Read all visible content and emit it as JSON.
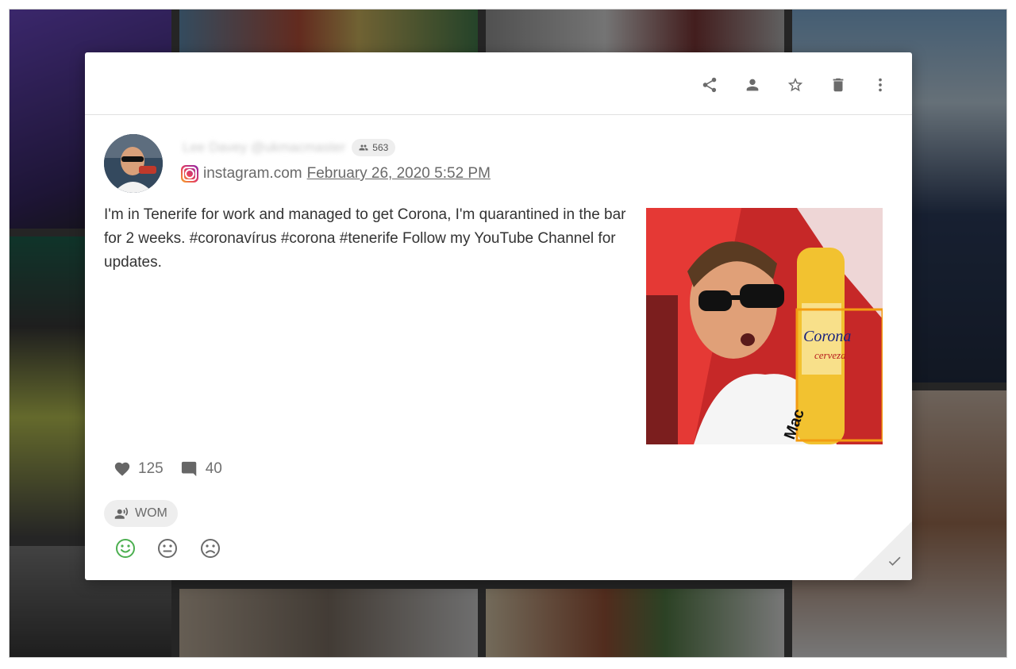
{
  "toolbar": {
    "icons": [
      "share-icon",
      "person-icon",
      "star-icon",
      "delete-icon",
      "more-vert-icon"
    ]
  },
  "post": {
    "author_name": "Lee Davey @ukmacmaster",
    "followers": "563",
    "source_site": "instagram.com",
    "date": "February 26, 2020 5:52 PM",
    "text": "I'm in Tenerife for work and managed to get Corona, I'm quarantined in the bar for 2 weeks. #coronavírus #corona #tenerife Follow my YouTube Channel for updates.",
    "likes": "125",
    "comments": "40"
  },
  "tag": {
    "label": "WOM"
  },
  "sentiment": {
    "options": [
      "positive",
      "neutral",
      "negative"
    ],
    "selected": "positive",
    "colors": {
      "selected": "#4caf50",
      "default": "#6b6b6b"
    }
  },
  "image_overlay_text": {
    "bottle_brand": "Corona",
    "bottle_sub": "cerveza",
    "shirt_text": "Mac"
  }
}
